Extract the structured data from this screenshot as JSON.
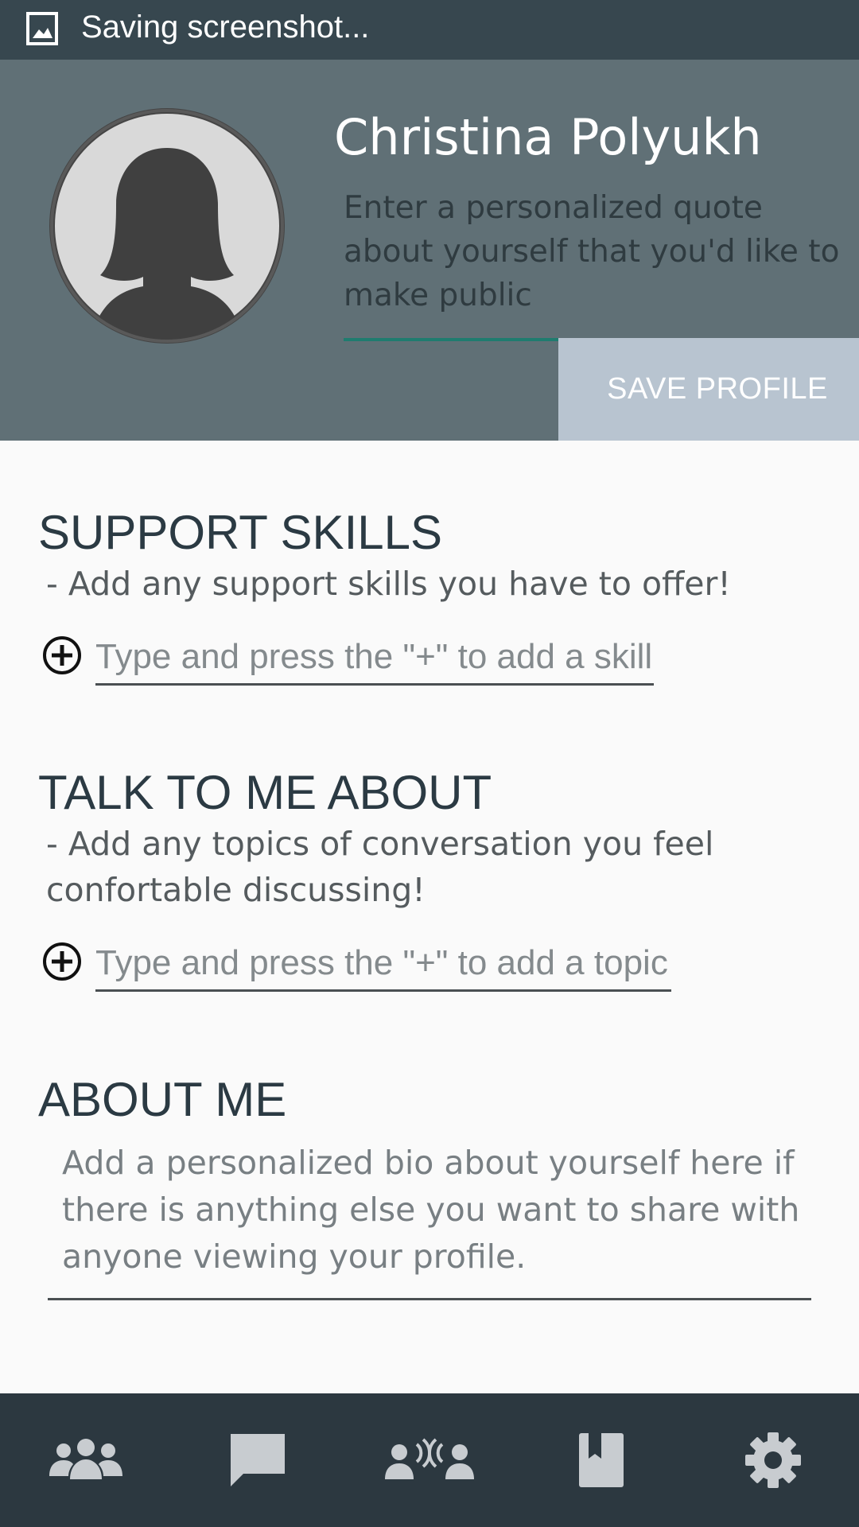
{
  "status_bar": {
    "text": "Saving screenshot...",
    "icon": "image-icon"
  },
  "profile": {
    "name": "Christina Polyukh",
    "quote_placeholder": "Enter a personalized quote about yourself that you'd like to make public",
    "avatar_icon": "female-avatar-icon",
    "save_label": "SAVE PROFILE"
  },
  "support_skills": {
    "title": "SUPPORT SKILLS",
    "description": "- Add any support skills you have to offer!",
    "input_placeholder": "Type and press the \"+\" to add a skill",
    "add_icon": "add-circle-icon"
  },
  "talk_about": {
    "title": "TALK TO ME ABOUT",
    "description": "- Add any topics of conversation you feel confortable discussing!",
    "input_placeholder": "Type and press the \"+\" to add a topic",
    "add_icon": "add-circle-icon"
  },
  "about_me": {
    "title": "ABOUT ME",
    "bio_placeholder": "Add a personalized bio about yourself here if there is anything else you want to share with anyone viewing your profile."
  },
  "bottom_nav": {
    "items": [
      "people-icon",
      "chat-icon",
      "voice-call-icon",
      "book-icon",
      "settings-icon"
    ]
  },
  "colors": {
    "status_bar": "#37474f",
    "header": "#607076",
    "save_button": "#b8c4d0",
    "accent_underline": "#1f7c6f",
    "bottom_nav": "#2c3840",
    "nav_icon": "#c8ccd0"
  }
}
